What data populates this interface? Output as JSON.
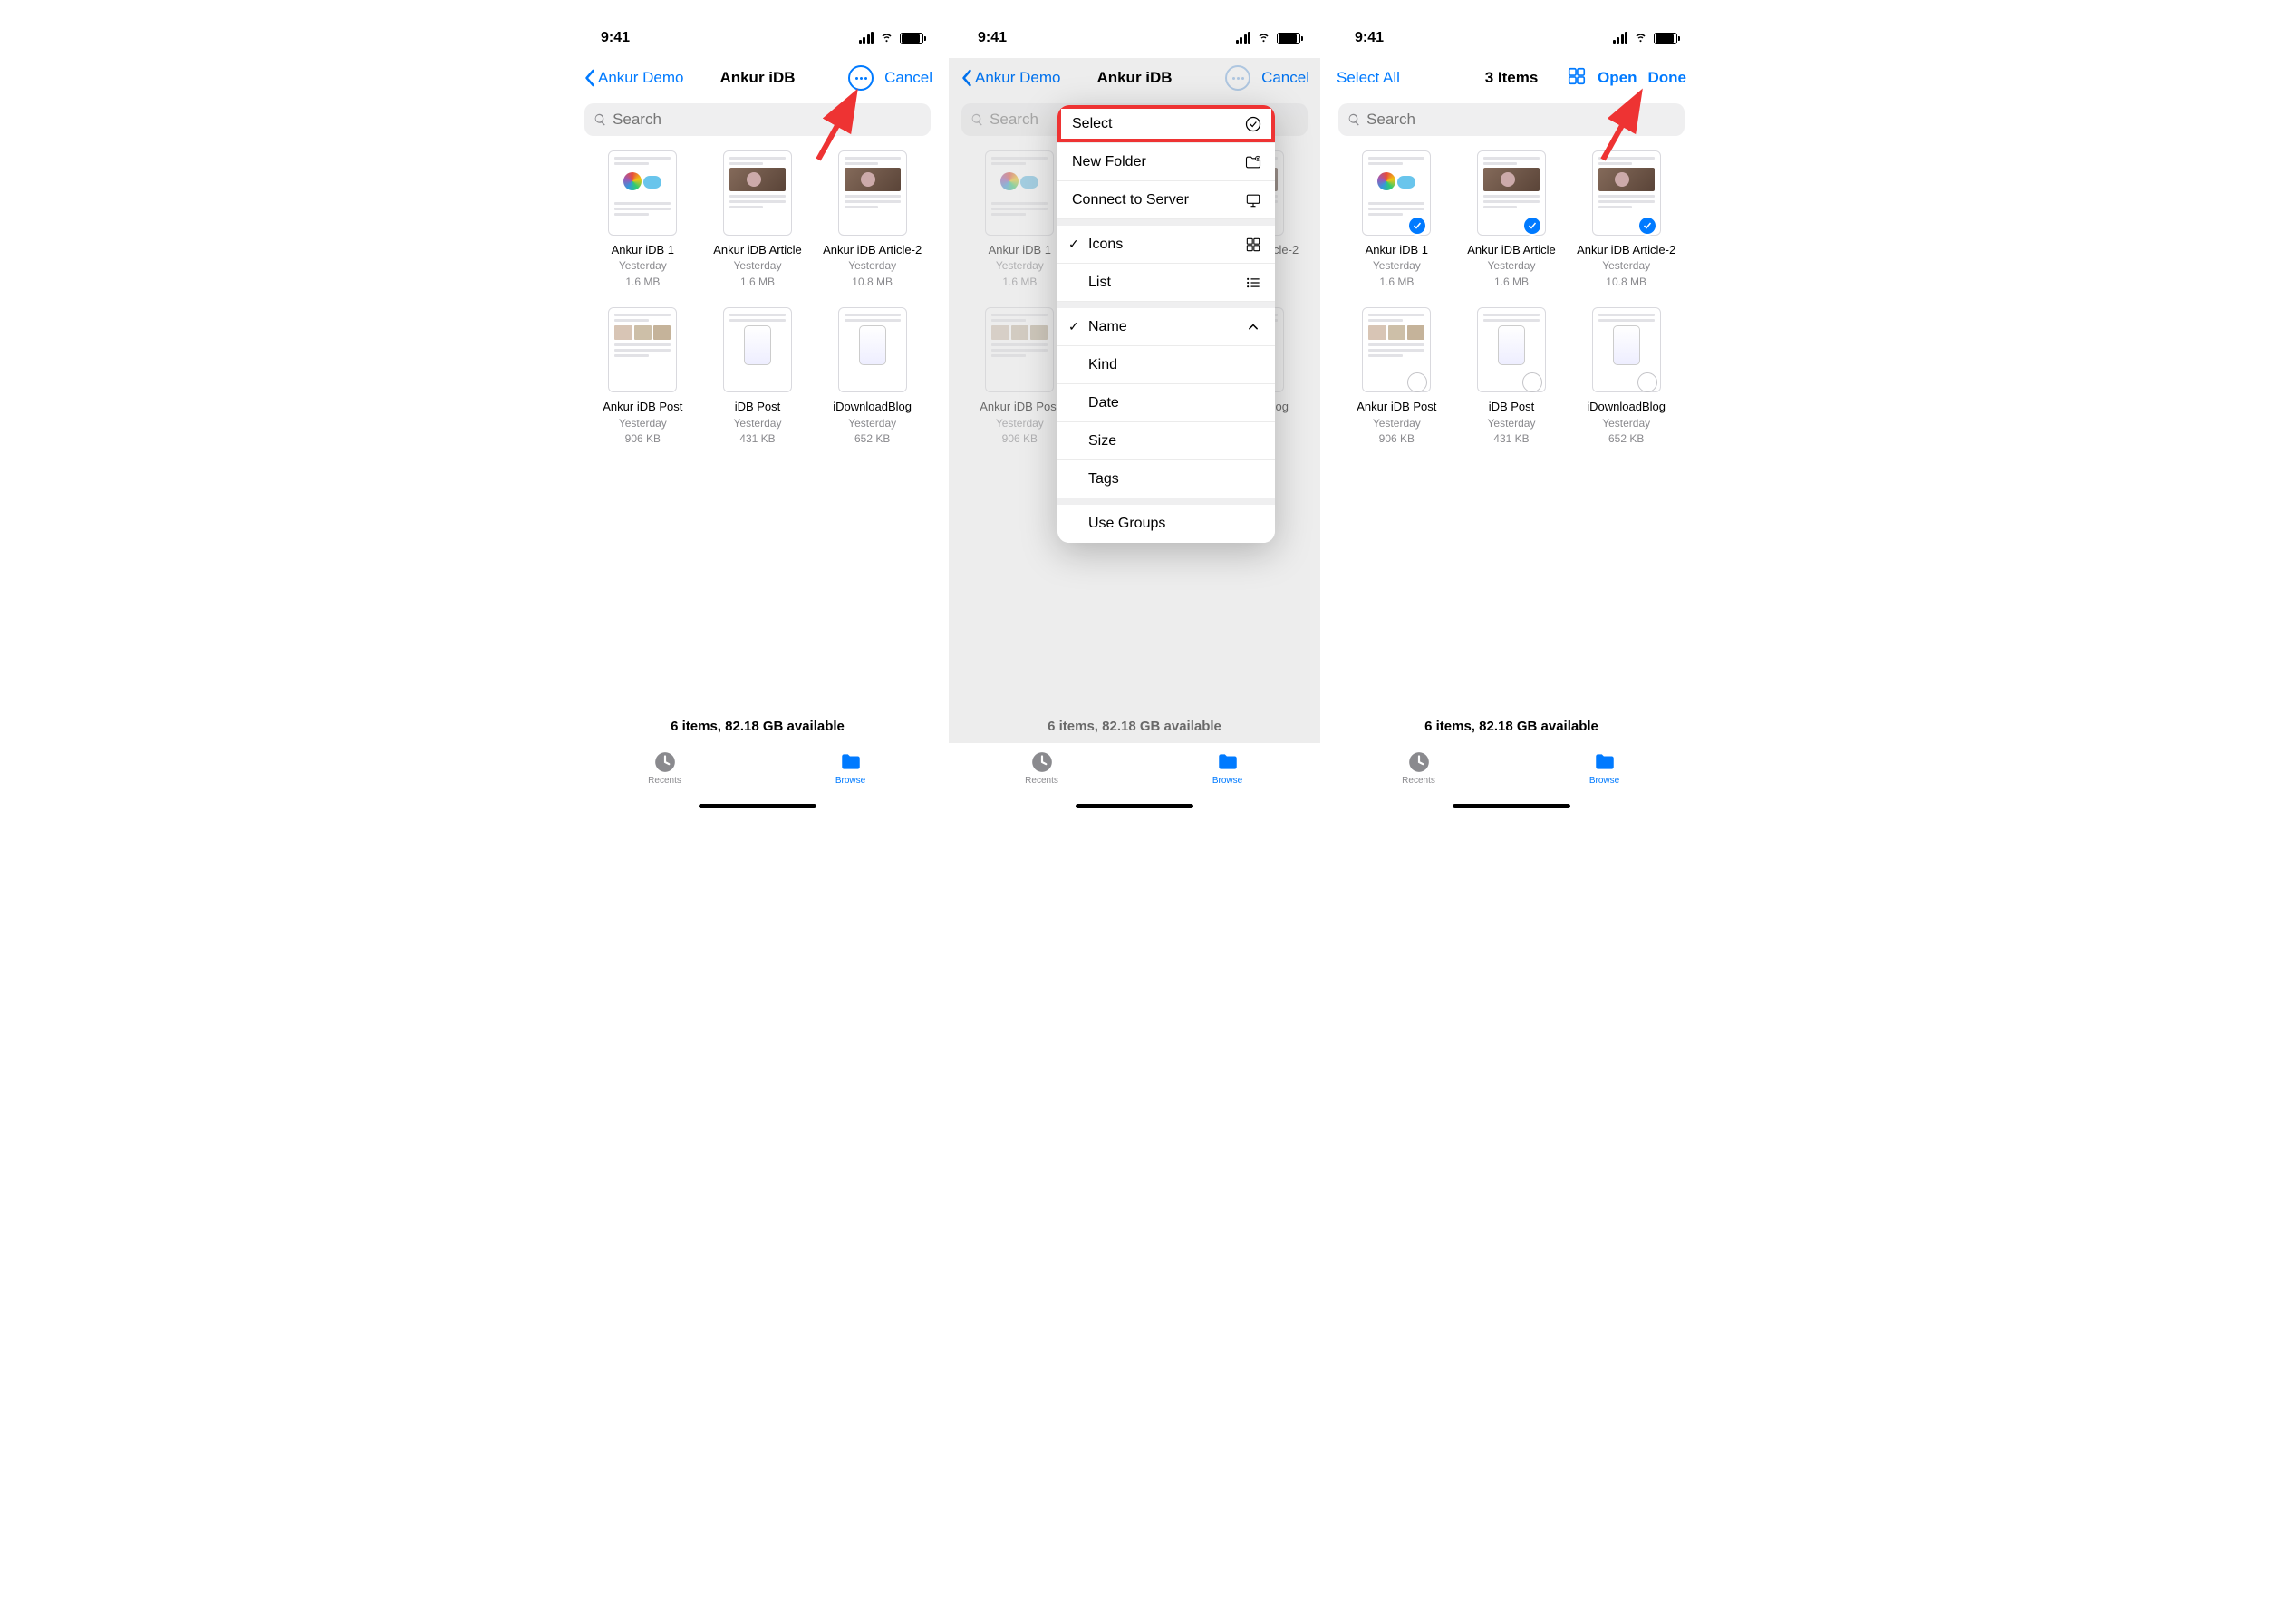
{
  "status": {
    "time": "9:41"
  },
  "screen1": {
    "nav": {
      "back": "Ankur Demo",
      "title": "Ankur iDB",
      "cancel": "Cancel"
    },
    "search_placeholder": "Search"
  },
  "screen2": {
    "nav": {
      "back": "Ankur Demo",
      "title": "Ankur iDB",
      "cancel": "Cancel"
    },
    "search_placeholder": "Search",
    "menu": {
      "select": "Select",
      "new_folder": "New Folder",
      "connect": "Connect to Server",
      "icons": "Icons",
      "list": "List",
      "name": "Name",
      "kind": "Kind",
      "date": "Date",
      "size": "Size",
      "tags": "Tags",
      "use_groups": "Use Groups"
    }
  },
  "screen3": {
    "nav": {
      "select_all": "Select All",
      "title": "3 Items",
      "open": "Open",
      "done": "Done"
    },
    "search_placeholder": "Search"
  },
  "files": [
    {
      "name": "Ankur iDB 1",
      "date": "Yesterday",
      "size": "1.6 MB",
      "kind": "wheel"
    },
    {
      "name": "Ankur iDB Article",
      "date": "Yesterday",
      "size": "1.6 MB",
      "kind": "photo"
    },
    {
      "name": "Ankur iDB Article-2",
      "date": "Yesterday",
      "size": "10.8 MB",
      "kind": "photo"
    },
    {
      "name": "Ankur iDB Post",
      "date": "Yesterday",
      "size": "906 KB",
      "kind": "post"
    },
    {
      "name": "iDB Post",
      "date": "Yesterday",
      "size": "431 KB",
      "kind": "device"
    },
    {
      "name": "iDownloadBlog",
      "date": "Yesterday",
      "size": "652 KB",
      "kind": "device"
    }
  ],
  "selection": [
    true,
    true,
    true,
    false,
    false,
    false
  ],
  "summary": "6 items, 82.18 GB available",
  "tabs": {
    "recents": "Recents",
    "browse": "Browse"
  }
}
